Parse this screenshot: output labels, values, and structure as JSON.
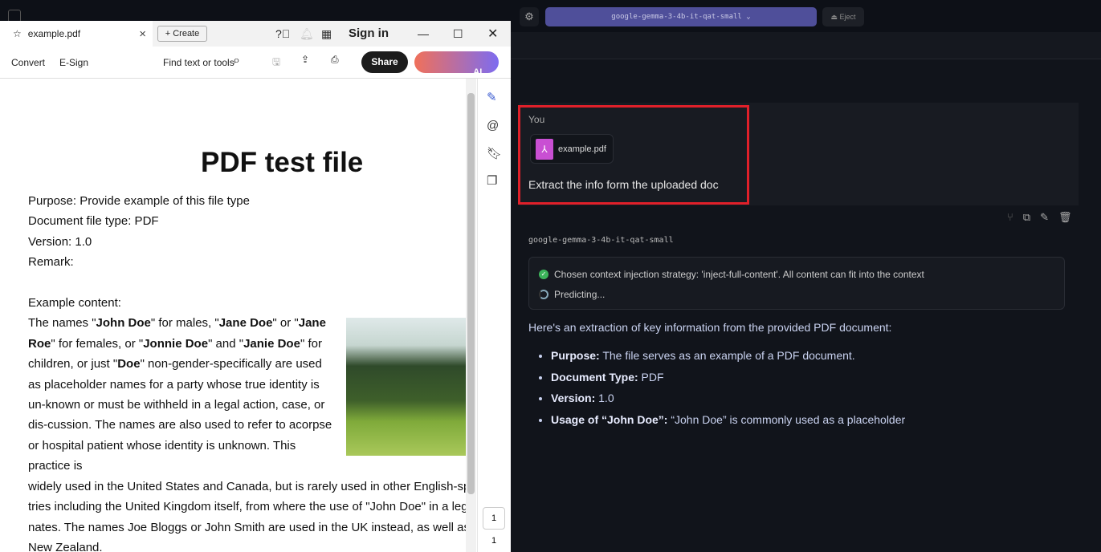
{
  "pdf": {
    "tab_title": "example.pdf",
    "create": "Create",
    "sign_in": "Sign in",
    "convert": "Convert",
    "esign": "E-Sign",
    "find": "Find text or tools",
    "share": "Share",
    "ai": "AI Assistant",
    "title": "PDF test file",
    "lines": [
      "Purpose: Provide example of this file type",
      "Document file type: PDF",
      "Version: 1.0",
      "Remark:"
    ],
    "example_label": "Example content:",
    "p1": [
      {
        "t": "The names \""
      },
      {
        "b": "John Doe"
      },
      {
        "t": "\" for males, \""
      },
      {
        "b": "Jane Doe"
      },
      {
        "t": "\" or \""
      },
      {
        "b": "Jane Roe"
      },
      {
        "t": "\" for females, or \""
      },
      {
        "b": "Jonnie Doe"
      },
      {
        "t": "\" and \""
      },
      {
        "b": "Janie Doe"
      },
      {
        "t": "\" for children, or just \""
      },
      {
        "b": "Doe"
      },
      {
        "t": "\" non-gender-specifically are used as placeholder names for a party whose true identity is un-known or must be withheld in a legal action, case, or dis-cussion. The names are also used to refer to acorpse or hospital patient whose identity is unknown. This practice is"
      }
    ],
    "p2": [
      "widely used in the United States and Canada, but is rarely used in other English-sp",
      "tries including the United Kingdom itself, from where the use of \"John Doe\" in a lega",
      "nates. The names Joe Bloggs or John Smith are used in the UK instead, as well as",
      "New Zealand."
    ],
    "page_input": "1",
    "page_total": "1"
  },
  "chat": {
    "model": "google-gemma-3-4b-it-qat-small",
    "eject": "Eject",
    "you": "You",
    "file": "example.pdf",
    "message": "Extract the info form the uploaded doc",
    "strategy": "Chosen context injection strategy: 'inject-full-content'. All content can fit into the context",
    "predicting": "Predicting...",
    "intro": "Here's an extraction of key information from the provided PDF document:",
    "bullets": [
      {
        "k": "Purpose:",
        "v": " The file serves as an example of a PDF document."
      },
      {
        "k": "Document Type:",
        "v": " PDF"
      },
      {
        "k": "Version:",
        "v": " 1.0"
      },
      {
        "k": "Usage of “John Doe”:",
        "v": " “John Doe” is commonly used as a placeholder"
      }
    ]
  }
}
